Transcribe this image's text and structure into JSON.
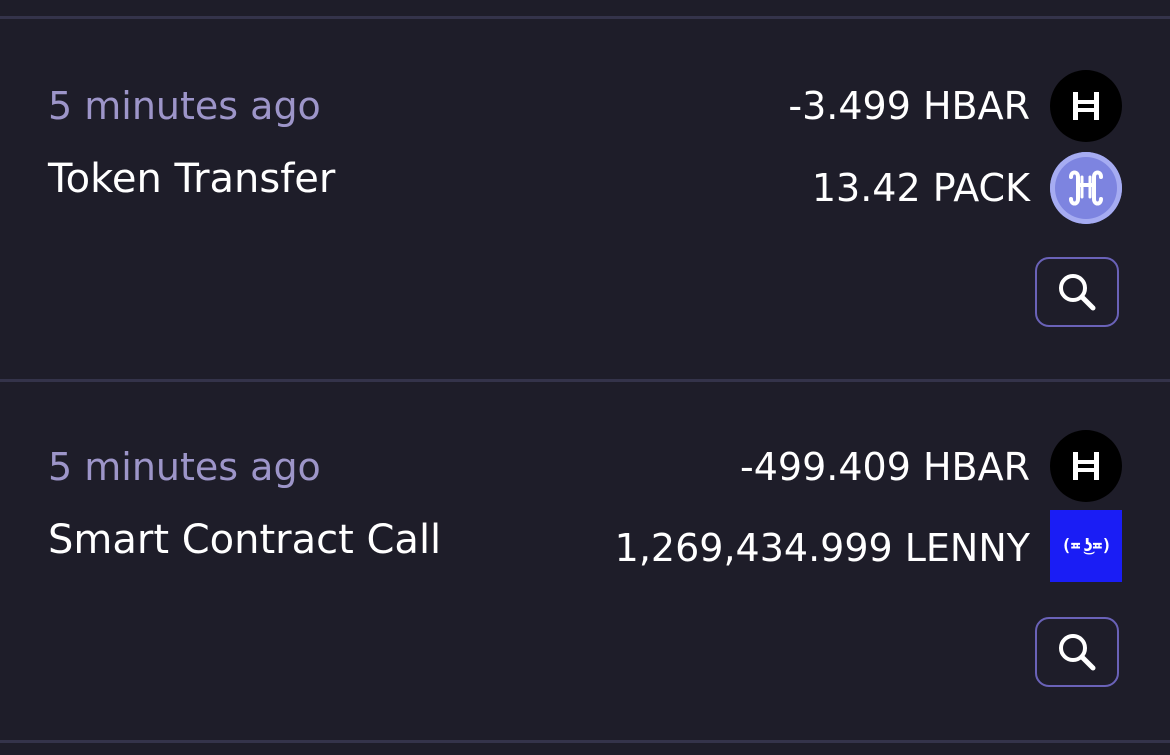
{
  "transactions": [
    {
      "time": "5 minutes ago",
      "type": "Token Transfer",
      "transfers": [
        {
          "amount": "-3.499 HBAR",
          "icon": "hbar-icon"
        },
        {
          "amount": "13.42 PACK",
          "icon": "pack-icon"
        }
      ]
    },
    {
      "time": "5 minutes ago",
      "type": "Smart Contract Call",
      "transfers": [
        {
          "amount": "-499.409 HBAR",
          "icon": "hbar-icon"
        },
        {
          "amount": "1,269,434.999 LENNY",
          "icon": "lenny-icon",
          "icon_text": "(≖ ͜ʖ≖)"
        }
      ]
    }
  ],
  "colors": {
    "background": "#1e1d29",
    "divider": "#34334a",
    "time_text": "#9d95c9",
    "button_border": "#6a62b8"
  }
}
